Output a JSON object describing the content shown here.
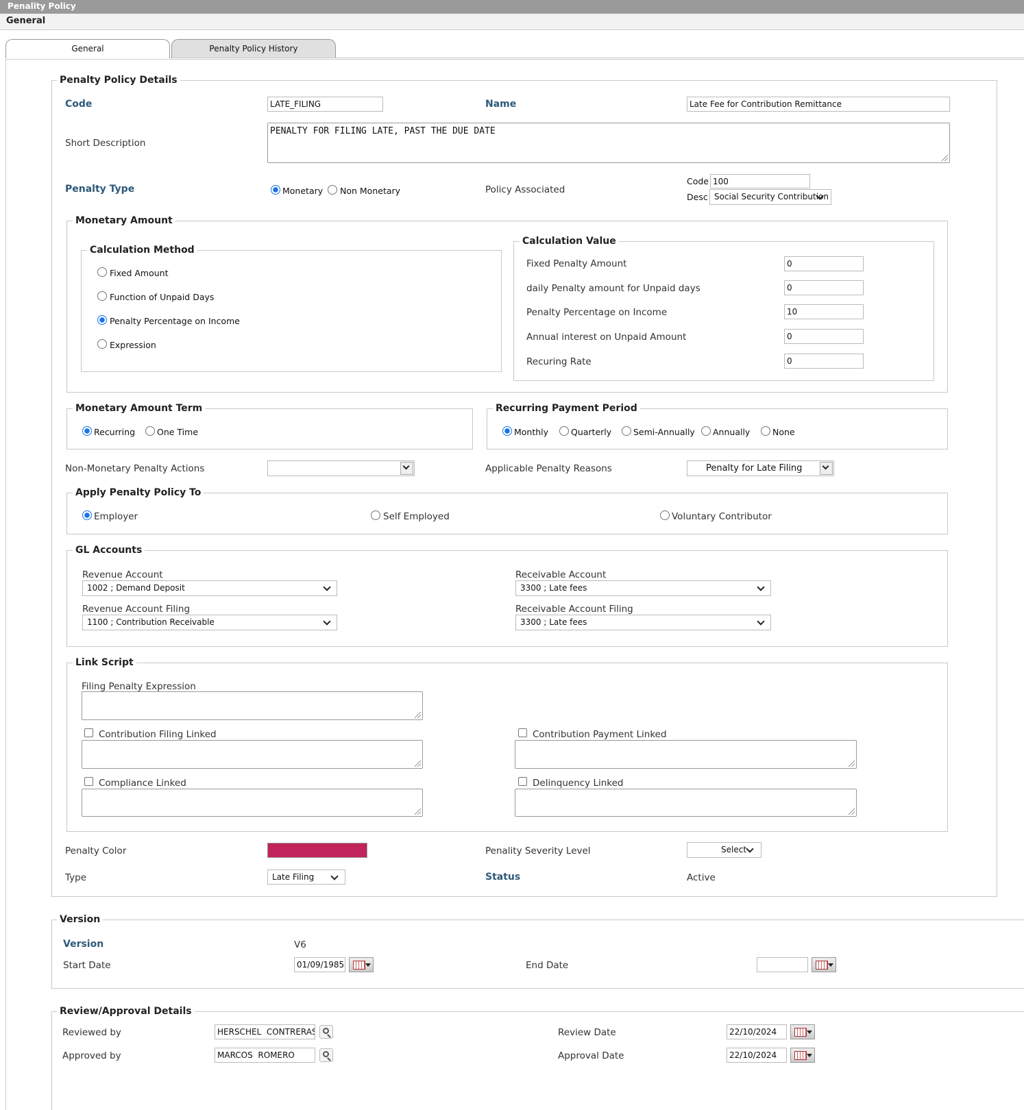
{
  "app": {
    "title": "Penality Policy",
    "section": "General"
  },
  "tabs": [
    "General",
    "Penalty Policy History"
  ],
  "details": {
    "legend": "Penalty Policy Details",
    "code_label": "Code",
    "code_value": "LATE_FILING",
    "name_label": "Name",
    "name_value": "Late Fee for Contribution Remittance",
    "short_desc_label": "Short Description",
    "short_desc_value": "PENALTY FOR FILING LATE, PAST THE DUE DATE",
    "penalty_type_label": "Penalty Type",
    "penalty_type_options": [
      "Monetary",
      "Non Monetary"
    ],
    "penalty_type_selected": "Monetary",
    "policy_associated_label": "Policy Associated",
    "pa_code_label": "Code",
    "pa_code_value": "100",
    "pa_desc_label": "Desc",
    "pa_desc_value": "Social Security Contribution"
  },
  "monetary": {
    "legend": "Monetary Amount",
    "calc_method_legend": "Calculation Method",
    "calc_methods": [
      "Fixed Amount",
      "Function of Unpaid Days",
      "Penalty Percentage on Income",
      "Expression"
    ],
    "calc_method_selected": "Penalty Percentage on Income",
    "calc_value_legend": "Calculation Value",
    "calc_values": [
      {
        "label": "Fixed Penalty Amount",
        "value": "0"
      },
      {
        "label": "daily Penalty amount for Unpaid days",
        "value": "0"
      },
      {
        "label": "Penalty Percentage on Income",
        "value": "10"
      },
      {
        "label": "Annual interest on Unpaid Amount",
        "value": "0"
      },
      {
        "label": "Recuring Rate",
        "value": "0"
      }
    ]
  },
  "term": {
    "legend": "Monetary Amount Term",
    "options": [
      "Recurring",
      "One Time"
    ],
    "selected": "Recurring"
  },
  "period": {
    "legend": "Recurring Payment Period",
    "options": [
      "Monthly",
      "Quarterly",
      "Semi-Annually",
      "Annually",
      "None"
    ],
    "selected": "Monthly"
  },
  "non_monetary_label": "Non-Monetary Penalty Actions",
  "non_monetary_value": "",
  "reasons_label": "Applicable Penalty Reasons",
  "reasons_value": "Penalty for Late Filing",
  "apply": {
    "legend": "Apply Penalty Policy To",
    "options": [
      "Employer",
      "Self Employed",
      "Voluntary Contributor"
    ],
    "selected": "Employer"
  },
  "gl": {
    "legend": "GL Accounts",
    "revenue_label": "Revenue Account",
    "revenue_value": "1002 ; Demand Deposit",
    "receivable_label": "Receivable Account",
    "receivable_value": "3300 ; Late fees",
    "revenue_filing_label": "Revenue Account Filing",
    "revenue_filing_value": "1100 ; Contribution Receivable",
    "receivable_filing_label": "Receivable Account Filing",
    "receivable_filing_value": "3300 ; Late fees"
  },
  "link": {
    "legend": "Link Script",
    "filing_expr_label": "Filing Penalty Expression",
    "contrib_filing_label": "Contribution Filing Linked",
    "contrib_payment_label": "Contribution Payment Linked",
    "compliance_label": "Compliance Linked",
    "delinquency_label": "Delinquency Linked"
  },
  "misc": {
    "color_label": "Penalty Color",
    "color_value": "#c0245a",
    "severity_label": "Penality Severity Level",
    "severity_value": "Select",
    "type_label": "Type",
    "type_value": "Late Filing",
    "status_label": "Status",
    "status_value": "Active"
  },
  "version": {
    "legend": "Version",
    "version_label": "Version",
    "version_value": "V6",
    "start_label": "Start Date",
    "start_value": "01/09/1985",
    "end_label": "End Date",
    "end_value": ""
  },
  "review": {
    "legend": "Review/Approval Details",
    "reviewed_label": "Reviewed by",
    "reviewed_value": "HERSCHEL  CONTRERAS",
    "approved_label": "Approved by",
    "approved_value": "MARCOS  ROMERO",
    "review_date_label": "Review Date",
    "review_date_value": "22/10/2024",
    "approval_date_label": "Approval Date",
    "approval_date_value": "22/10/2024"
  },
  "colors": {
    "titlebar": "#9a9a9a",
    "label_blue": "#2d5a7a",
    "radio_on": "#1a73e8"
  },
  "icons": [
    "search-icon",
    "calendar-icon",
    "chevron-down-icon",
    "resize-grip-icon"
  ]
}
